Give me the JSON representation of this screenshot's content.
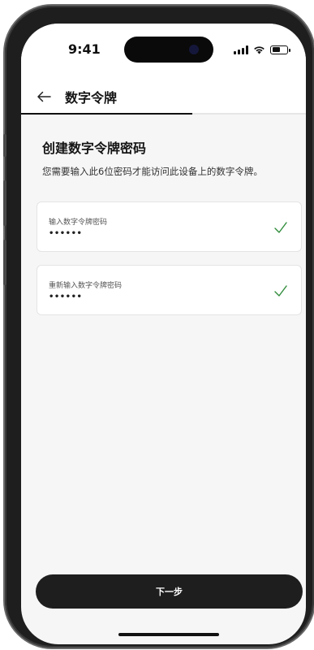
{
  "status_bar": {
    "time": "9:41"
  },
  "nav": {
    "title": "数字令牌"
  },
  "progress": {
    "fraction": 0.6
  },
  "main": {
    "heading": "创建数字令牌密码",
    "description": "您需要输入此6位密码才能访问此设备上的数字令牌。",
    "fields": [
      {
        "label": "输入数字令牌密码",
        "value": "••••••"
      },
      {
        "label": "重新输入数字令牌密码",
        "value": "••••••"
      }
    ]
  },
  "footer": {
    "next_label": "下一步"
  },
  "colors": {
    "accent_check": "#2e8b3a",
    "button_bg": "#1e1e1e"
  }
}
